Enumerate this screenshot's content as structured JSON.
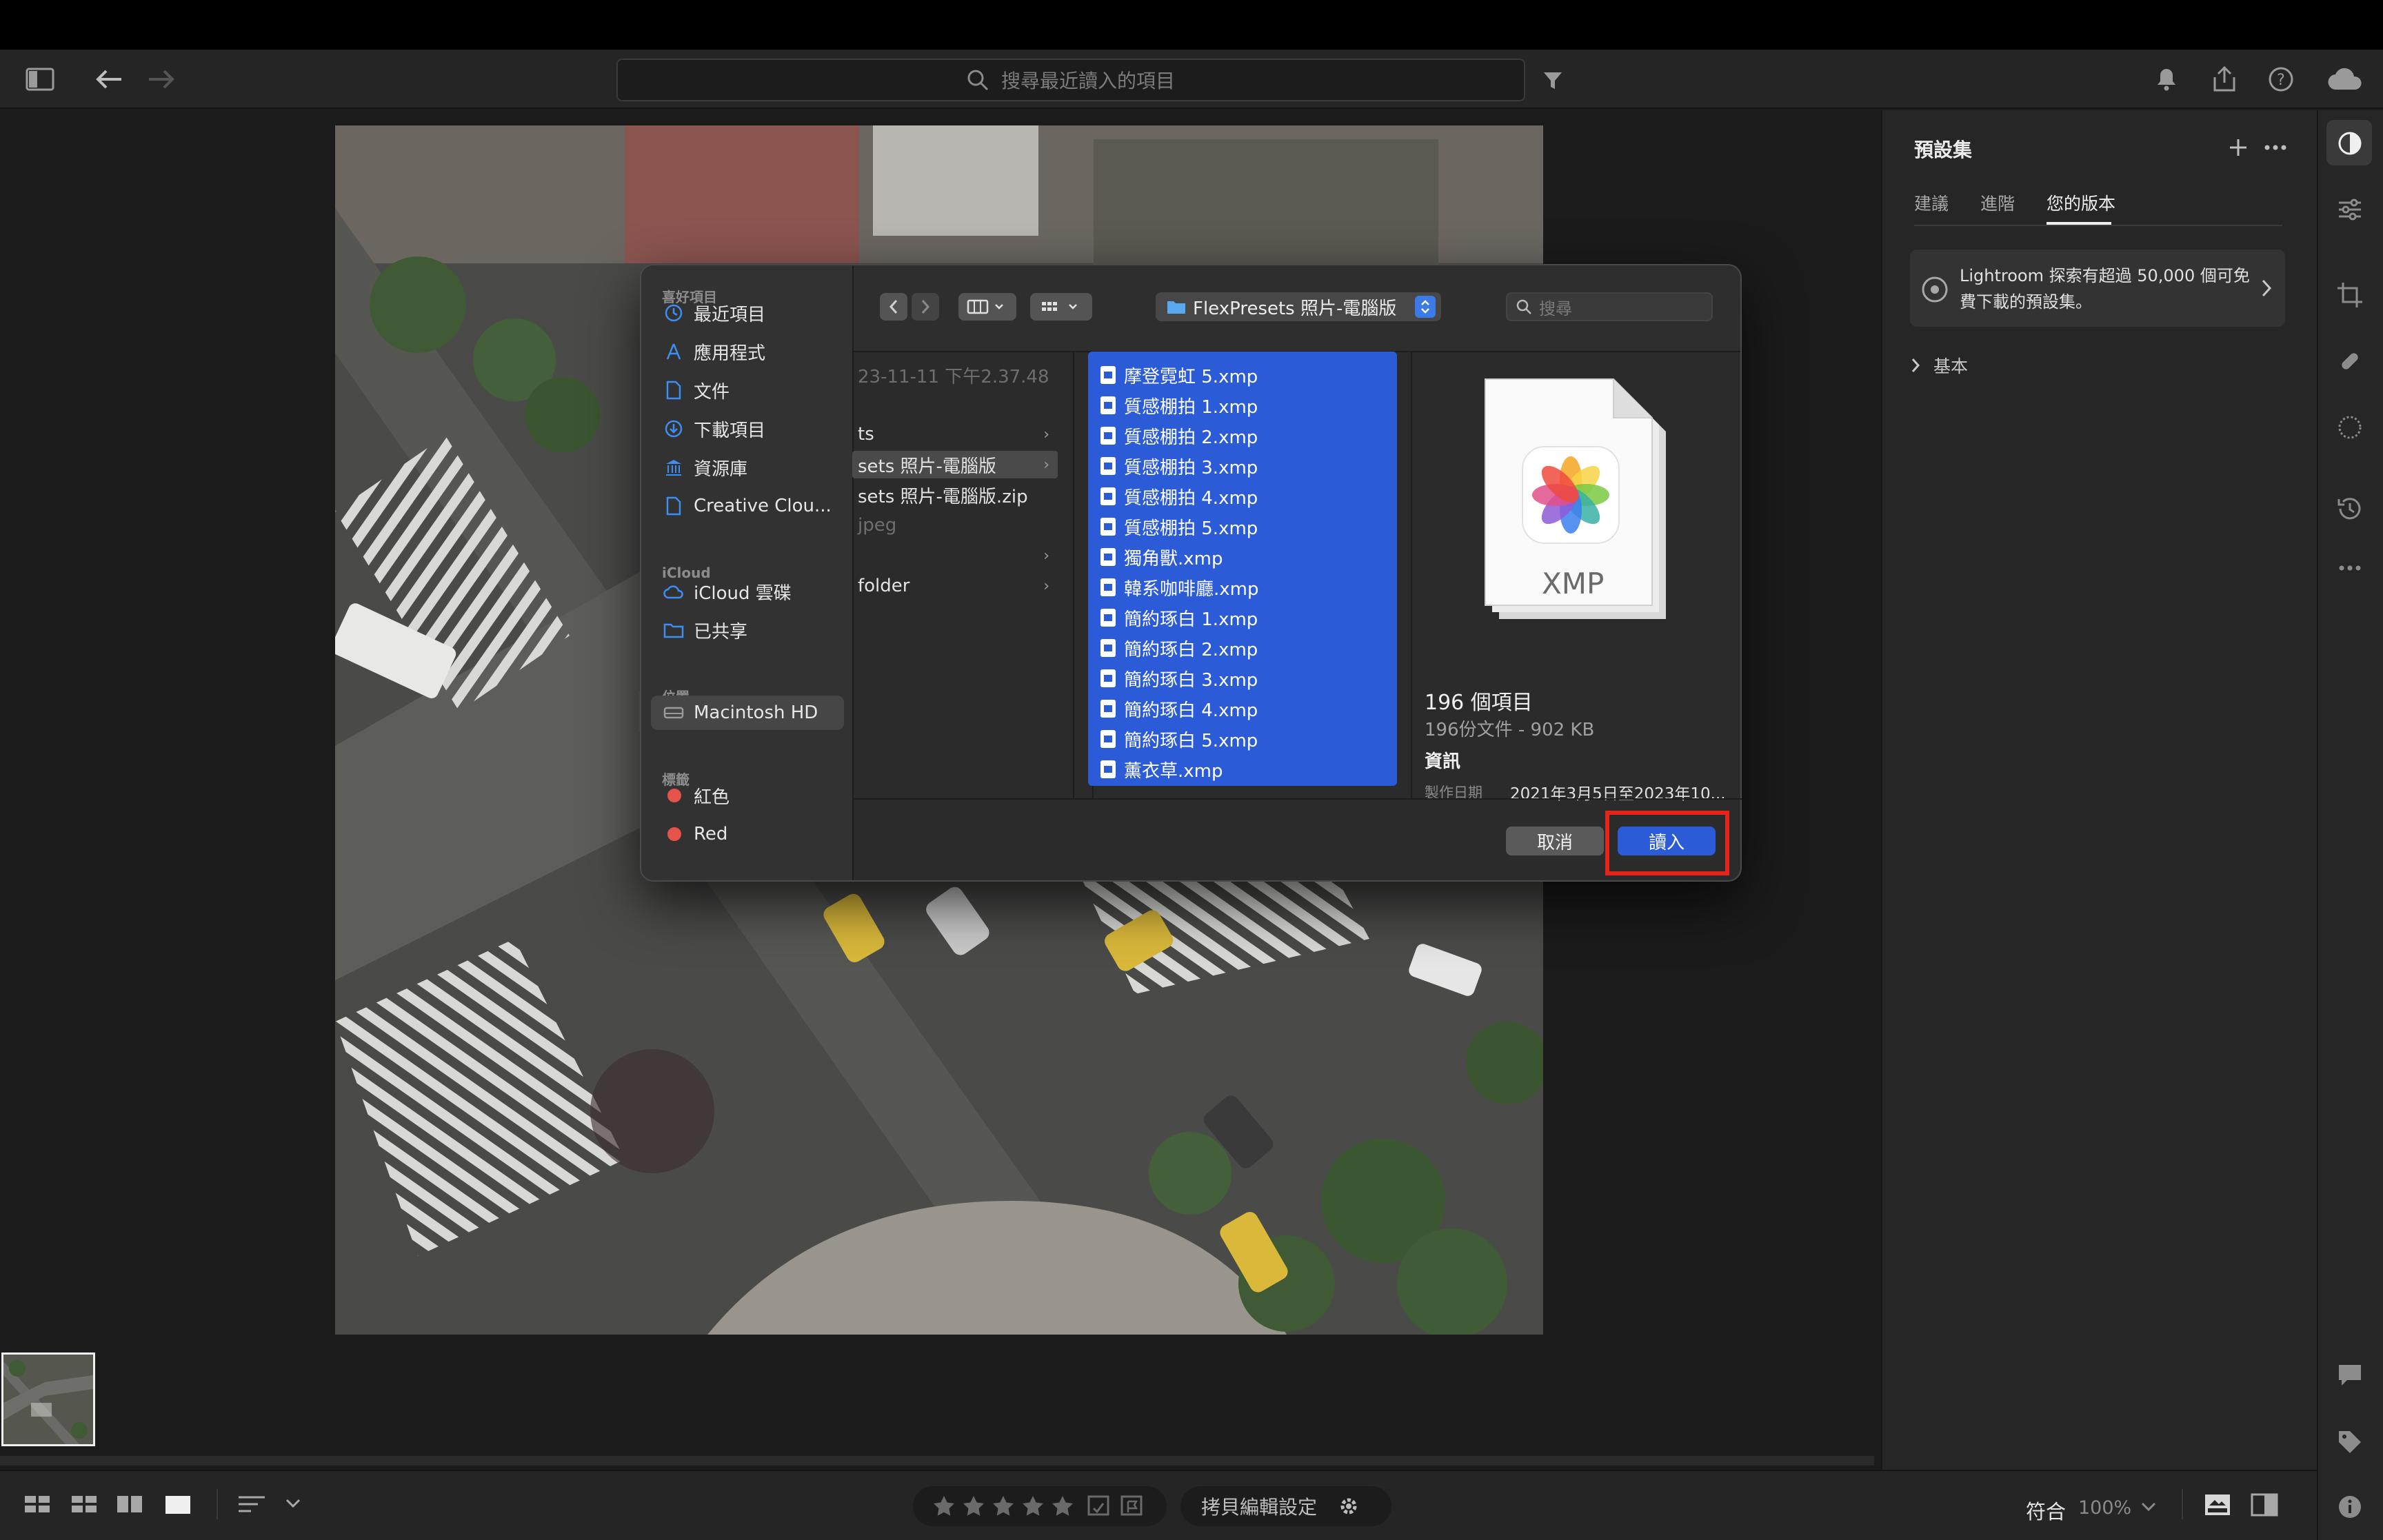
{
  "toolbar": {
    "search_placeholder": "搜尋最近讀入的項目"
  },
  "right_panel": {
    "title": "預設集",
    "tabs": [
      "建議",
      "進階",
      "您的版本"
    ],
    "active_tab": "您的版本",
    "promo_text_line1": "Lightroom 探索有超過 50,000 個可免",
    "promo_text_line2": "費下載的預設集。",
    "group_label": "基本"
  },
  "dialog": {
    "sidebar": {
      "favorites_header": "喜好項目",
      "favorites": [
        "最近項目",
        "應用程式",
        "文件",
        "下載項目",
        "資源庫",
        "Creative Clou..."
      ],
      "icloud_header": "iCloud",
      "icloud": [
        "iCloud 雲碟",
        "已共享"
      ],
      "locations_header": "位置",
      "locations": [
        "Macintosh HD"
      ],
      "tags_header": "標籤",
      "tags": [
        "紅色",
        "Red"
      ]
    },
    "path_label": "FlexPresets 照片-電腦版",
    "search_placeholder": "搜尋",
    "column1": [
      {
        "text": "23-11-11 下午2.37.48",
        "dim": true,
        "chevron": false
      },
      {
        "text": "ts",
        "dim": false,
        "chevron": true
      },
      {
        "text": "sets 照片-電腦版",
        "dim": false,
        "chevron": true,
        "selected": true
      },
      {
        "text": "sets 照片-電腦版.zip",
        "dim": false,
        "chevron": false
      },
      {
        "text": "jpeg",
        "dim": true,
        "chevron": false
      },
      {
        "text": "",
        "dim": false,
        "chevron": true
      },
      {
        "text": "folder",
        "dim": false,
        "chevron": true
      }
    ],
    "files": [
      "摩登霓虹 5.xmp",
      "質感棚拍 1.xmp",
      "質感棚拍 2.xmp",
      "質感棚拍 3.xmp",
      "質感棚拍 4.xmp",
      "質感棚拍 5.xmp",
      "獨角獸.xmp",
      "韓系咖啡廳.xmp",
      "簡約琢白 1.xmp",
      "簡約琢白 2.xmp",
      "簡約琢白 3.xmp",
      "簡約琢白 4.xmp",
      "簡約琢白 5.xmp",
      "薰衣草.xmp"
    ],
    "preview": {
      "icon_label": "XMP",
      "count": "196 個項目",
      "summary": "196份文件 - 902 KB",
      "info_header": "資訊",
      "created_label": "製作日期",
      "created_value": "2021年3月5日至2023年10..."
    },
    "cancel_label": "取消",
    "import_label": "讀入",
    "accent_color": "#2c5bd8",
    "highlight_color": "#e2261c"
  },
  "bottom_bar": {
    "copy_settings_label": "拷貝編輯設定",
    "fit_label": "符合",
    "zoom_label": "100%"
  }
}
